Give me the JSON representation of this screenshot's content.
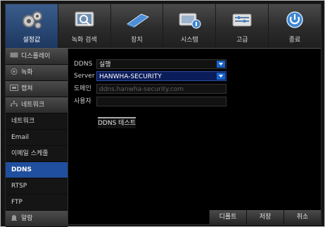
{
  "top_menu": [
    {
      "label": "설정값",
      "icon": "gear-icon",
      "active": true
    },
    {
      "label": "녹화 검색",
      "icon": "search-record-icon",
      "active": false
    },
    {
      "label": "장치",
      "icon": "device-icon",
      "active": false
    },
    {
      "label": "시스템",
      "icon": "system-icon",
      "active": false
    },
    {
      "label": "고급",
      "icon": "advanced-icon",
      "active": false
    },
    {
      "label": "종료",
      "icon": "power-icon",
      "active": false
    }
  ],
  "sidebar": {
    "items": [
      {
        "label": "디스플레이",
        "type": "category"
      },
      {
        "label": "녹화",
        "type": "category"
      },
      {
        "label": "캡쳐",
        "type": "category"
      },
      {
        "label": "네트워크",
        "type": "category"
      },
      {
        "label": "네트워크",
        "type": "sub"
      },
      {
        "label": "Email",
        "type": "sub"
      },
      {
        "label": "이메일 스케줄",
        "type": "sub"
      },
      {
        "label": "DDNS",
        "type": "sub",
        "active": true
      },
      {
        "label": "RTSP",
        "type": "sub"
      },
      {
        "label": "FTP",
        "type": "sub"
      },
      {
        "label": "알람",
        "type": "category"
      }
    ]
  },
  "form": {
    "ddns_label": "DDNS",
    "ddns_value": "실행",
    "server_label": "Server",
    "server_value": "HANWHA-SECURITY",
    "domain_label": "도메인",
    "domain_value": "ddns.hanwha-security.com",
    "user_label": "사용자",
    "user_value": "",
    "test_button": "DDNS 테스트"
  },
  "buttons": {
    "default": "디폴트",
    "save": "저장",
    "cancel": "취소"
  },
  "colors": {
    "active_blue": "#1f4f9e",
    "selected_field": "#0b1c5a",
    "dropdown_arrow": "#1a63c6"
  }
}
